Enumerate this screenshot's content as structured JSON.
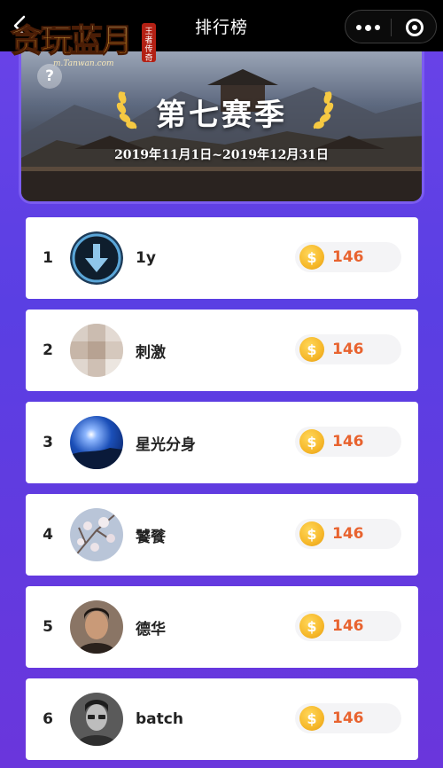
{
  "header": {
    "title": "排行榜",
    "logo_text": "贪玩蓝月",
    "logo_url": "m.Tanwan.com",
    "logo_seal": "王者传奇"
  },
  "banner": {
    "help": "?",
    "season": "第七赛季",
    "dates": "2019年11月1日~2019年12月31日"
  },
  "ranking": [
    {
      "rank": "1",
      "name": "1y",
      "score": "146",
      "avatar": "download-arrow"
    },
    {
      "rank": "2",
      "name": "刺激",
      "score": "146",
      "avatar": "blurred-photo"
    },
    {
      "rank": "3",
      "name": "星光分身",
      "score": "146",
      "avatar": "night-sky"
    },
    {
      "rank": "4",
      "name": "饕餮",
      "score": "146",
      "avatar": "blossom-branch"
    },
    {
      "rank": "5",
      "name": "德华",
      "score": "146",
      "avatar": "portrait"
    },
    {
      "rank": "6",
      "name": "batch",
      "score": "146",
      "avatar": "portrait-bw"
    }
  ],
  "colors": {
    "background": "#6248e4",
    "score_text": "#e8632f",
    "coin": "#f6b82a"
  }
}
